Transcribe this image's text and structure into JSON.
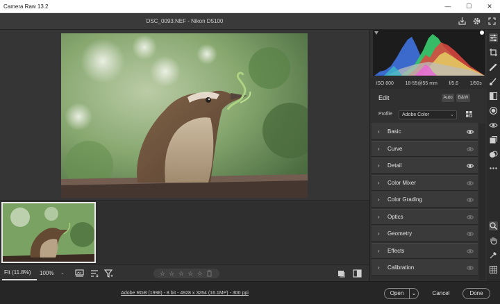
{
  "app": {
    "title": "Camera Raw 13.2",
    "window_controls": [
      "—",
      "☐",
      "✕"
    ]
  },
  "header": {
    "file_name": "DSC_0093.NEF  -  Nikon D5100",
    "icons": [
      "save-icon",
      "gear-icon",
      "fullscreen-icon"
    ]
  },
  "exif": {
    "iso": "ISO 800",
    "lens": "18-55@55 mm",
    "aperture": "f/5.6",
    "shutter": "1/50s"
  },
  "edit": {
    "label": "Edit",
    "auto_label": "Auto",
    "bw_label": "B&W",
    "profile_label": "Profile",
    "profile_value": "Adobe Color"
  },
  "sections": [
    {
      "label": "Basic",
      "eye": "on"
    },
    {
      "label": "Curve",
      "eye": "dim"
    },
    {
      "label": "Detail",
      "eye": "on"
    },
    {
      "label": "Color Mixer",
      "eye": "dim"
    },
    {
      "label": "Color Grading",
      "eye": "dim"
    },
    {
      "label": "Optics",
      "eye": "dim"
    },
    {
      "label": "Geometry",
      "eye": "dim"
    },
    {
      "label": "Effects",
      "eye": "dim"
    },
    {
      "label": "Calibration",
      "eye": "dim"
    }
  ],
  "bottom": {
    "zoom_fit": "Fit (11.8%)",
    "zoom_value": "100%",
    "stars": [
      "☆",
      "☆",
      "☆",
      "☆",
      "☆"
    ]
  },
  "footer": {
    "workflow_info": "Adobe RGB (1998) - 8 bit - 4928 x 3264 (16.1MP) - 300 ppi",
    "open_label": "Open",
    "cancel_label": "Cancel",
    "done_label": "Done"
  },
  "colors": {
    "panel_bg": "#303030",
    "section_bg": "#3a3a3a",
    "canvas_bg": "#353535",
    "histogram_blue": "#3d6fd6",
    "histogram_green": "#38c46b",
    "histogram_red": "#e0453f",
    "histogram_yellow": "#e3c860"
  }
}
